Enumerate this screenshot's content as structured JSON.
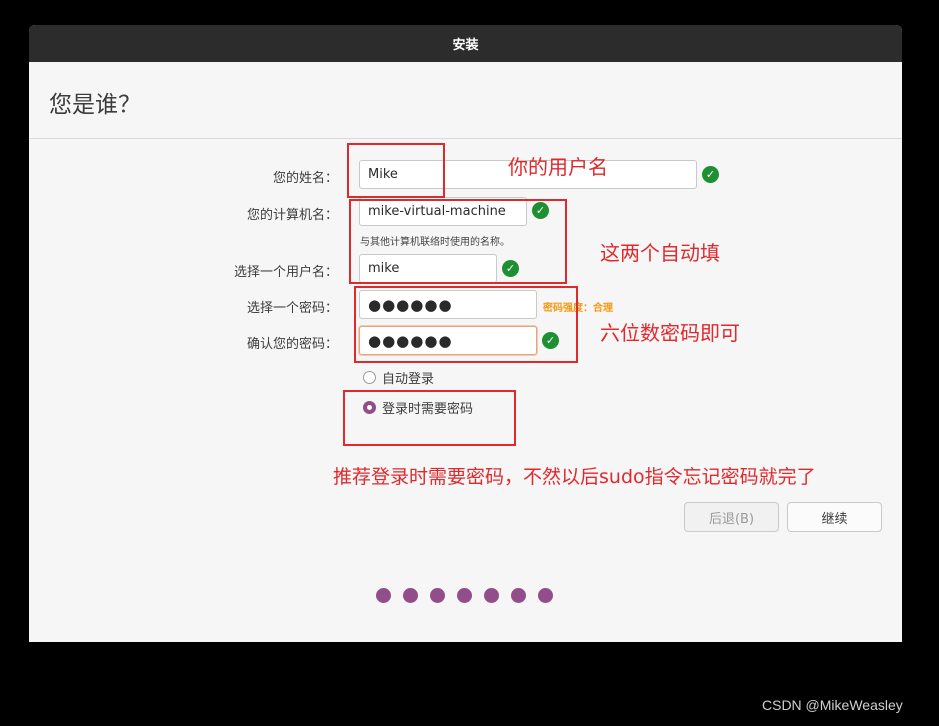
{
  "window": {
    "title": "安装"
  },
  "page": {
    "heading": "您是谁？"
  },
  "form": {
    "name": {
      "label": "您的姓名：",
      "value": "Mike"
    },
    "computer_name": {
      "label": "您的计算机名：",
      "value": "mike-virtual-machine",
      "hint": "与其他计算机联络时使用的名称。"
    },
    "username": {
      "label": "选择一个用户名：",
      "value": "mike"
    },
    "password": {
      "label": "选择一个密码：",
      "value": "●●●●●●",
      "strength": "密码强度：合理"
    },
    "confirm_password": {
      "label": "确认您的密码：",
      "value": "●●●●●●"
    },
    "login_options": [
      {
        "label": "自动登录",
        "checked": false
      },
      {
        "label": "登录时需要密码",
        "checked": true
      }
    ]
  },
  "buttons": {
    "back": "后退(B)",
    "continue": "继续"
  },
  "progress": {
    "total_steps": 7
  },
  "annotations": {
    "name_note": "你的用户名",
    "auto_note": "这两个自动填",
    "password_note": "六位数密码即可",
    "login_note": "推荐登录时需要密码，不然以后sudo指令忘记密码就完了"
  },
  "watermark": "CSDN @MikeWeasley",
  "colors": {
    "accent": "#924d8b",
    "check": "#1e8f32",
    "strength": "#f39a14",
    "annotation": "#e0292d",
    "titlebar": "#2c2c2c"
  }
}
